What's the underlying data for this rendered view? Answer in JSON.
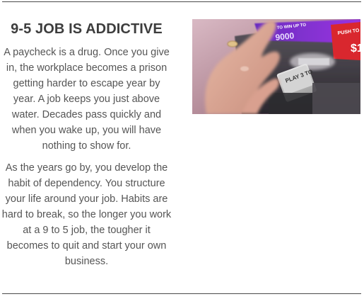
{
  "article": {
    "heading": "9-5 JOB IS ADDICTIVE",
    "paragraphs": [
      "A paycheck is a drug. Once you give in, the workplace becomes a prison getting harder to escape year by year. A job keeps you just above water. Decades pass quickly and when you wake up, you will have nothing to show for.",
      "As the years go by, you develop the habit of dependency. You structure your life around your job. Habits are hard to break, so the longer you work at a 9 to 5 job, the tougher it becomes to quit and start your own business."
    ]
  },
  "photo": {
    "sign_text_top": "TO WIN UP TO",
    "sign_number": "9000",
    "push_label": "PUSH TO",
    "push_amount": "$1",
    "button_text": "PLAY 3 TO"
  }
}
